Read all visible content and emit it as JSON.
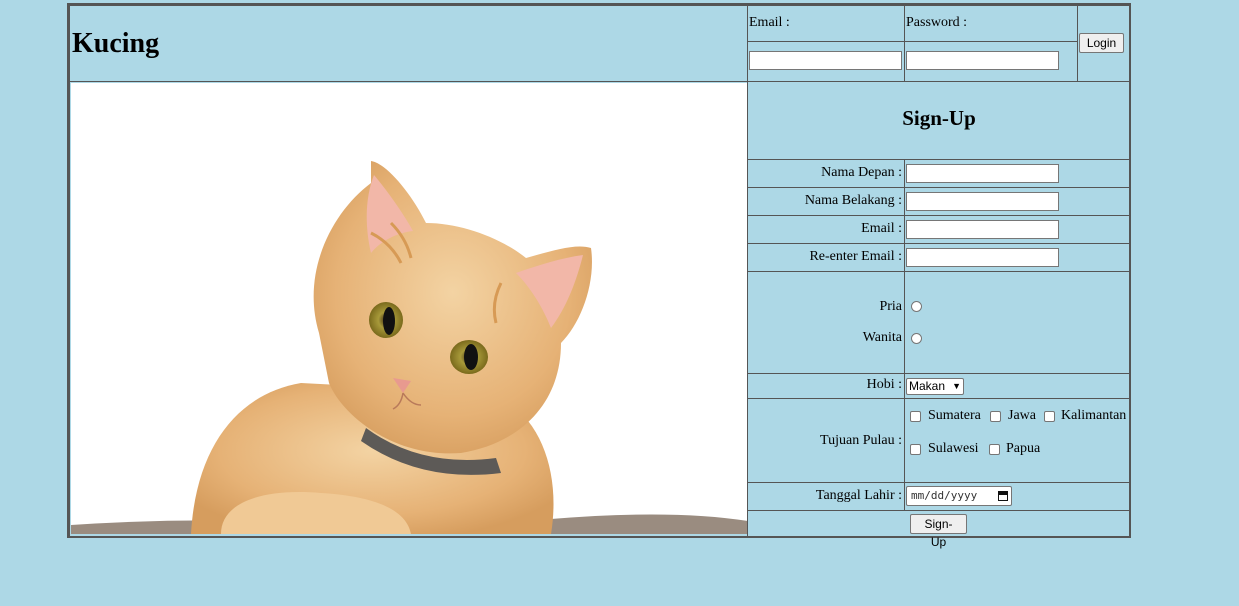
{
  "header": {
    "title": "Kucing",
    "email_label": "Email :",
    "password_label": "Password :",
    "login_label": "Login",
    "email_value": "",
    "password_value": ""
  },
  "photo": {
    "subject": "orange-tabby-cat-photo"
  },
  "signup": {
    "title": "Sign-Up",
    "first_name_label": "Nama Depan :",
    "last_name_label": "Nama Belakang :",
    "email_label": "Email :",
    "reenter_email_label": "Re-enter Email :",
    "gender_options": [
      "Pria",
      "Wanita"
    ],
    "hobby_label": "Hobi :",
    "hobby_selected": "Makan",
    "islands_label": "Tujuan Pulau :",
    "islands": [
      "Sumatera",
      "Jawa",
      "Kalimantan",
      "Sulawesi",
      "Papua"
    ],
    "birthdate_label": "Tanggal Lahir :",
    "birthdate_placeholder": "mm/dd/yyyy",
    "submit_label": "Sign-Up"
  },
  "colors": {
    "background": "#add8e6",
    "border": "#555555"
  }
}
